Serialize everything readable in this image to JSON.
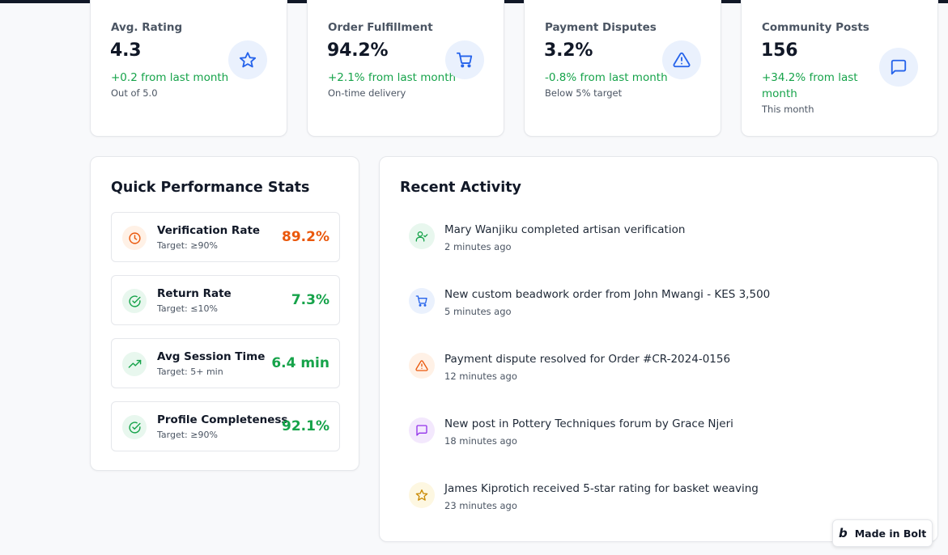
{
  "stats": [
    {
      "label": "Avg. Rating",
      "value": "4.3",
      "change": "+0.2 from last month",
      "sub": "Out of 5.0",
      "icon": "star-icon"
    },
    {
      "label": "Order Fulfillment",
      "value": "94.2%",
      "change": "+2.1% from last month",
      "sub": "On-time delivery",
      "icon": "cart-icon"
    },
    {
      "label": "Payment Disputes",
      "value": "3.2%",
      "change": "-0.8% from last month",
      "sub": "Below 5% target",
      "icon": "alert-triangle-icon"
    },
    {
      "label": "Community Posts",
      "value": "156",
      "change_line1": "+34.2% from last",
      "change_line2": "month",
      "sub": "This month",
      "icon": "message-square-icon"
    }
  ],
  "performance": {
    "title": "Quick Performance Stats",
    "items": [
      {
        "name": "Verification Rate",
        "target": "Target: ≥90%",
        "value": "89.2%",
        "status": "warning",
        "icon": "clock-icon"
      },
      {
        "name": "Return Rate",
        "target": "Target: ≤10%",
        "value": "7.3%",
        "status": "good",
        "icon": "check-circle-icon"
      },
      {
        "name": "Avg Session Time",
        "target": "Target: 5+ min",
        "value": "6.4 min",
        "status": "good",
        "icon": "trending-up-icon"
      },
      {
        "name": "Profile Completeness",
        "target": "Target: ≥90%",
        "value": "92.1%",
        "status": "good",
        "icon": "check-circle-icon"
      }
    ]
  },
  "activity": {
    "title": "Recent Activity",
    "items": [
      {
        "text": "Mary Wanjiku completed artisan verification",
        "time": "2 minutes ago",
        "icon": "user-check-icon"
      },
      {
        "text": "New custom beadwork order from John Mwangi - KES 3,500",
        "time": "5 minutes ago",
        "icon": "cart-icon"
      },
      {
        "text": "Payment dispute resolved for Order #CR-2024-0156",
        "time": "12 minutes ago",
        "icon": "alert-triangle-icon"
      },
      {
        "text": "New post in Pottery Techniques forum by Grace Njeri",
        "time": "18 minutes ago",
        "icon": "message-square-icon"
      },
      {
        "text": "James Kiprotich received 5-star rating for basket weaving",
        "time": "23 minutes ago",
        "icon": "star-icon"
      }
    ]
  },
  "badge": {
    "label": "Made in Bolt",
    "icon": "bolt-logo-icon"
  },
  "colors": {
    "accent_blue": "#2563eb",
    "positive_green": "#16a34a",
    "warning_orange": "#ea580c",
    "purple": "#9333ea",
    "amber": "#ca8a04"
  }
}
